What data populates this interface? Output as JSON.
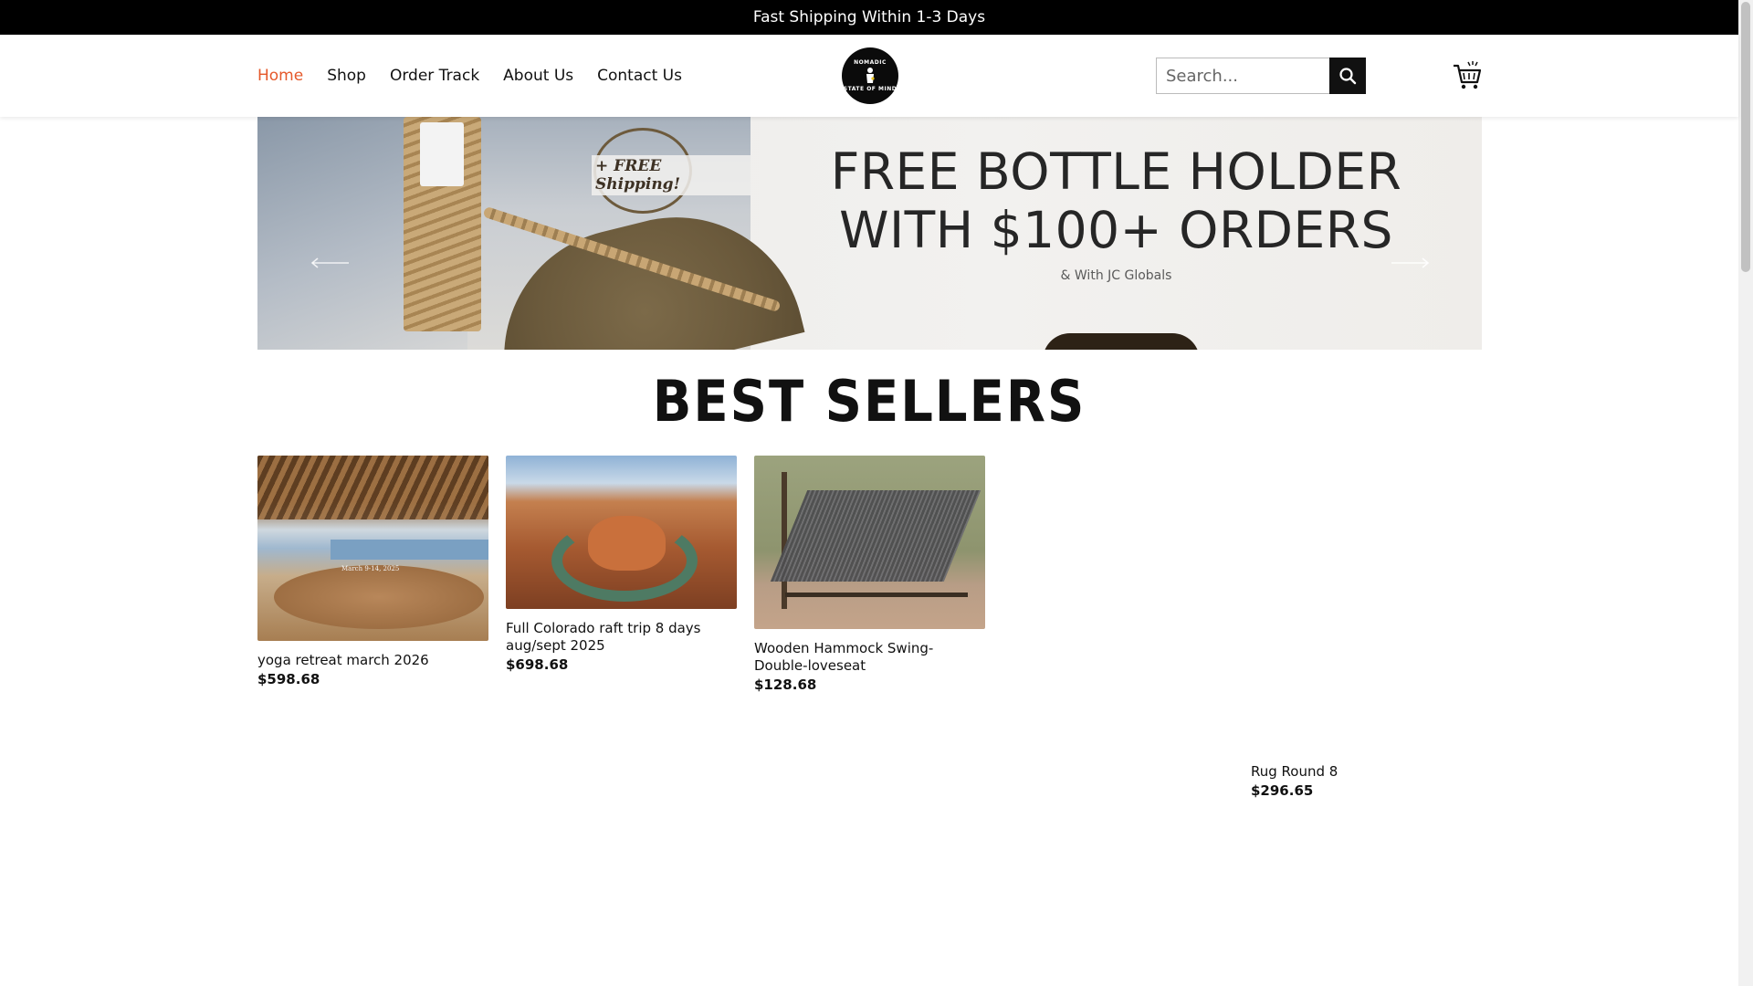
{
  "announcement": "Fast Shipping Within 1-3 Days",
  "nav": {
    "items": [
      "Home",
      "Shop",
      "Order Track",
      "About Us",
      "Contact Us"
    ],
    "active": "Home"
  },
  "logo": {
    "top_text": "NOMADIC",
    "bottom_text": "STATE OF MIND"
  },
  "search": {
    "placeholder": "Search..."
  },
  "banner": {
    "stamp_text": "+ FREE Shipping!",
    "headline_line1": "FREE BOTTLE HOLDER",
    "headline_line2": "WITH $100+ ORDERS",
    "subline": "& With JC Globals"
  },
  "section_title": "BEST SELLERS",
  "products": [
    {
      "name": "yoga retreat march 2026",
      "price": "$598.68",
      "image_caption": "March 9-14, 2025"
    },
    {
      "name": "Full Colorado raft trip 8 days aug/sept 2025",
      "price": "$698.68"
    },
    {
      "name": "Wooden Hammock Swing- Double-loveseat",
      "price": "$128.68"
    },
    {
      "name": "Rug Round 8",
      "price": "$296.65"
    }
  ],
  "colors": {
    "accent": "#e5582a",
    "topbar": "#000000",
    "text": "#111111"
  },
  "icons": {
    "search": "search-icon",
    "cart": "cart-icon",
    "prev": "arrow-left-icon",
    "next": "arrow-right-icon"
  }
}
